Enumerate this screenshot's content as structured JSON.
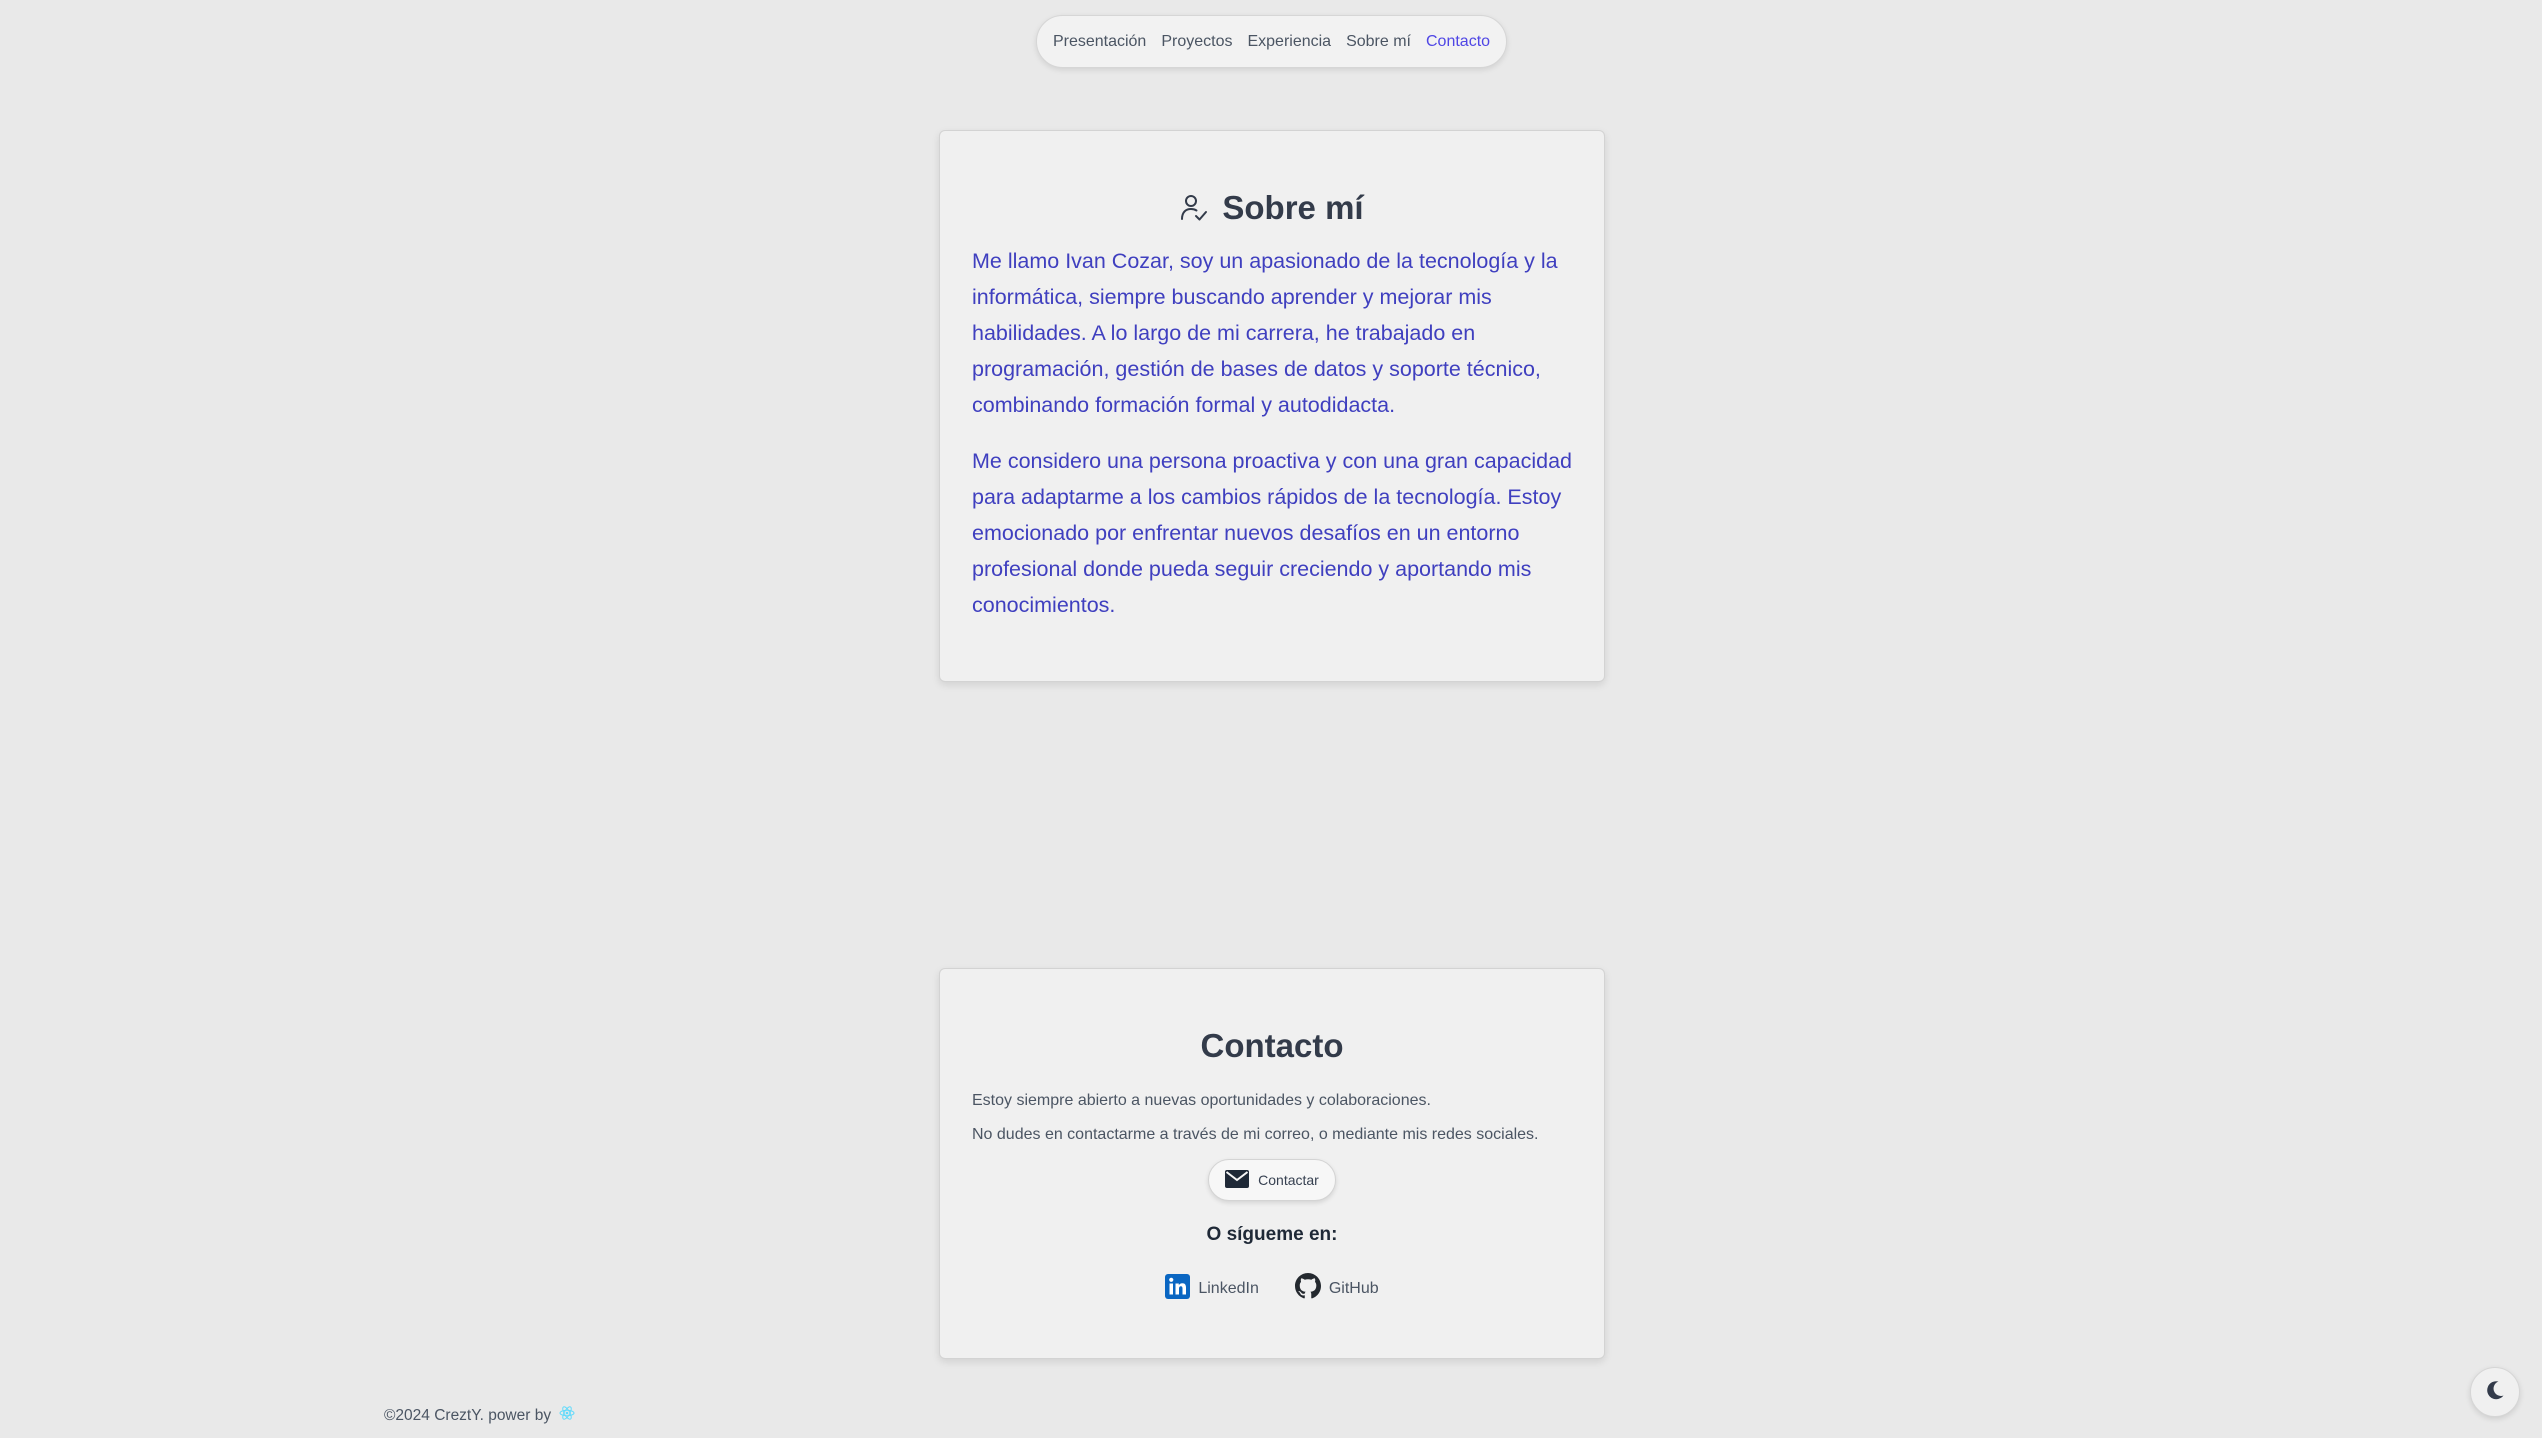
{
  "nav": {
    "items": [
      {
        "label": "Presentación",
        "active": false
      },
      {
        "label": "Proyectos",
        "active": false
      },
      {
        "label": "Experiencia",
        "active": false
      },
      {
        "label": "Sobre mí",
        "active": false
      },
      {
        "label": "Contacto",
        "active": true
      }
    ],
    "active_color": "#4f46e5"
  },
  "about": {
    "icon": "user-check-icon",
    "title": "Sobre mí",
    "paragraphs": [
      "Me llamo Ivan Cozar, soy un apasionado de la tecnología y la informática, siempre buscando aprender y mejorar mis habilidades. A lo largo de mi carrera, he trabajado en programación, gestión de bases de datos y soporte técnico, combinando formación formal y autodidacta.",
      "Me considero una persona proactiva y con una gran capacidad para adaptarme a los cambios rápidos de la tecnología. Estoy emocionado por enfrentar nuevos desafíos en un entorno profesional donde pueda seguir creciendo y aportando mis conocimientos."
    ],
    "text_color": "#3f3fbf"
  },
  "contact": {
    "title": "Contacto",
    "lines": [
      "Estoy siempre abierto a nuevas oportunidades y colaboraciones.",
      "No dudes en contactarme a través de mi correo, o mediante mis redes sociales."
    ],
    "button_label": "Contactar",
    "button_icon": "mail-icon",
    "follow_title": "O sígueme en:",
    "socials": [
      {
        "label": "LinkedIn",
        "icon": "linkedin-icon",
        "color": "#0a66c2"
      },
      {
        "label": "GitHub",
        "icon": "github-icon",
        "color": "#24292f"
      }
    ]
  },
  "footer": {
    "text": "©2024 CreztY. power by",
    "icon": "react-icon",
    "icon_color": "#61dafb"
  },
  "theme_toggle": {
    "icon": "moon-icon"
  }
}
